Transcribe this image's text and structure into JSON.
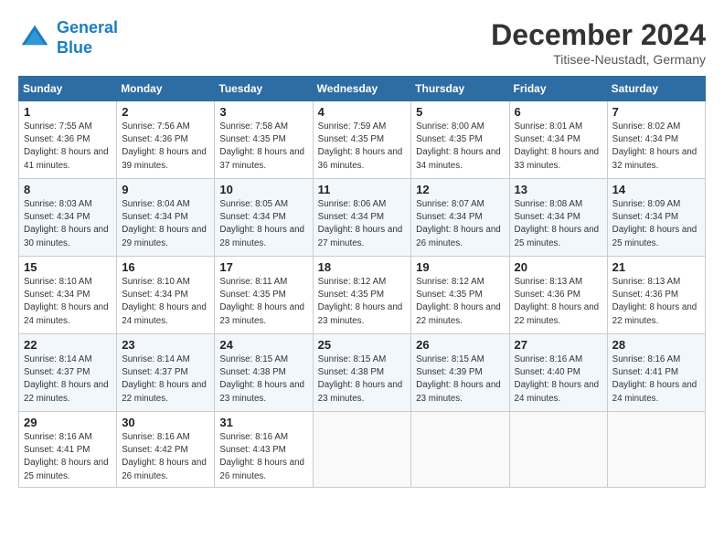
{
  "header": {
    "logo_line1": "General",
    "logo_line2": "Blue",
    "month_year": "December 2024",
    "location": "Titisee-Neustadt, Germany"
  },
  "weekdays": [
    "Sunday",
    "Monday",
    "Tuesday",
    "Wednesday",
    "Thursday",
    "Friday",
    "Saturday"
  ],
  "weeks": [
    [
      {
        "day": "1",
        "sunrise": "Sunrise: 7:55 AM",
        "sunset": "Sunset: 4:36 PM",
        "daylight": "Daylight: 8 hours and 41 minutes."
      },
      {
        "day": "2",
        "sunrise": "Sunrise: 7:56 AM",
        "sunset": "Sunset: 4:36 PM",
        "daylight": "Daylight: 8 hours and 39 minutes."
      },
      {
        "day": "3",
        "sunrise": "Sunrise: 7:58 AM",
        "sunset": "Sunset: 4:35 PM",
        "daylight": "Daylight: 8 hours and 37 minutes."
      },
      {
        "day": "4",
        "sunrise": "Sunrise: 7:59 AM",
        "sunset": "Sunset: 4:35 PM",
        "daylight": "Daylight: 8 hours and 36 minutes."
      },
      {
        "day": "5",
        "sunrise": "Sunrise: 8:00 AM",
        "sunset": "Sunset: 4:35 PM",
        "daylight": "Daylight: 8 hours and 34 minutes."
      },
      {
        "day": "6",
        "sunrise": "Sunrise: 8:01 AM",
        "sunset": "Sunset: 4:34 PM",
        "daylight": "Daylight: 8 hours and 33 minutes."
      },
      {
        "day": "7",
        "sunrise": "Sunrise: 8:02 AM",
        "sunset": "Sunset: 4:34 PM",
        "daylight": "Daylight: 8 hours and 32 minutes."
      }
    ],
    [
      {
        "day": "8",
        "sunrise": "Sunrise: 8:03 AM",
        "sunset": "Sunset: 4:34 PM",
        "daylight": "Daylight: 8 hours and 30 minutes."
      },
      {
        "day": "9",
        "sunrise": "Sunrise: 8:04 AM",
        "sunset": "Sunset: 4:34 PM",
        "daylight": "Daylight: 8 hours and 29 minutes."
      },
      {
        "day": "10",
        "sunrise": "Sunrise: 8:05 AM",
        "sunset": "Sunset: 4:34 PM",
        "daylight": "Daylight: 8 hours and 28 minutes."
      },
      {
        "day": "11",
        "sunrise": "Sunrise: 8:06 AM",
        "sunset": "Sunset: 4:34 PM",
        "daylight": "Daylight: 8 hours and 27 minutes."
      },
      {
        "day": "12",
        "sunrise": "Sunrise: 8:07 AM",
        "sunset": "Sunset: 4:34 PM",
        "daylight": "Daylight: 8 hours and 26 minutes."
      },
      {
        "day": "13",
        "sunrise": "Sunrise: 8:08 AM",
        "sunset": "Sunset: 4:34 PM",
        "daylight": "Daylight: 8 hours and 25 minutes."
      },
      {
        "day": "14",
        "sunrise": "Sunrise: 8:09 AM",
        "sunset": "Sunset: 4:34 PM",
        "daylight": "Daylight: 8 hours and 25 minutes."
      }
    ],
    [
      {
        "day": "15",
        "sunrise": "Sunrise: 8:10 AM",
        "sunset": "Sunset: 4:34 PM",
        "daylight": "Daylight: 8 hours and 24 minutes."
      },
      {
        "day": "16",
        "sunrise": "Sunrise: 8:10 AM",
        "sunset": "Sunset: 4:34 PM",
        "daylight": "Daylight: 8 hours and 24 minutes."
      },
      {
        "day": "17",
        "sunrise": "Sunrise: 8:11 AM",
        "sunset": "Sunset: 4:35 PM",
        "daylight": "Daylight: 8 hours and 23 minutes."
      },
      {
        "day": "18",
        "sunrise": "Sunrise: 8:12 AM",
        "sunset": "Sunset: 4:35 PM",
        "daylight": "Daylight: 8 hours and 23 minutes."
      },
      {
        "day": "19",
        "sunrise": "Sunrise: 8:12 AM",
        "sunset": "Sunset: 4:35 PM",
        "daylight": "Daylight: 8 hours and 22 minutes."
      },
      {
        "day": "20",
        "sunrise": "Sunrise: 8:13 AM",
        "sunset": "Sunset: 4:36 PM",
        "daylight": "Daylight: 8 hours and 22 minutes."
      },
      {
        "day": "21",
        "sunrise": "Sunrise: 8:13 AM",
        "sunset": "Sunset: 4:36 PM",
        "daylight": "Daylight: 8 hours and 22 minutes."
      }
    ],
    [
      {
        "day": "22",
        "sunrise": "Sunrise: 8:14 AM",
        "sunset": "Sunset: 4:37 PM",
        "daylight": "Daylight: 8 hours and 22 minutes."
      },
      {
        "day": "23",
        "sunrise": "Sunrise: 8:14 AM",
        "sunset": "Sunset: 4:37 PM",
        "daylight": "Daylight: 8 hours and 22 minutes."
      },
      {
        "day": "24",
        "sunrise": "Sunrise: 8:15 AM",
        "sunset": "Sunset: 4:38 PM",
        "daylight": "Daylight: 8 hours and 23 minutes."
      },
      {
        "day": "25",
        "sunrise": "Sunrise: 8:15 AM",
        "sunset": "Sunset: 4:38 PM",
        "daylight": "Daylight: 8 hours and 23 minutes."
      },
      {
        "day": "26",
        "sunrise": "Sunrise: 8:15 AM",
        "sunset": "Sunset: 4:39 PM",
        "daylight": "Daylight: 8 hours and 23 minutes."
      },
      {
        "day": "27",
        "sunrise": "Sunrise: 8:16 AM",
        "sunset": "Sunset: 4:40 PM",
        "daylight": "Daylight: 8 hours and 24 minutes."
      },
      {
        "day": "28",
        "sunrise": "Sunrise: 8:16 AM",
        "sunset": "Sunset: 4:41 PM",
        "daylight": "Daylight: 8 hours and 24 minutes."
      }
    ],
    [
      {
        "day": "29",
        "sunrise": "Sunrise: 8:16 AM",
        "sunset": "Sunset: 4:41 PM",
        "daylight": "Daylight: 8 hours and 25 minutes."
      },
      {
        "day": "30",
        "sunrise": "Sunrise: 8:16 AM",
        "sunset": "Sunset: 4:42 PM",
        "daylight": "Daylight: 8 hours and 26 minutes."
      },
      {
        "day": "31",
        "sunrise": "Sunrise: 8:16 AM",
        "sunset": "Sunset: 4:43 PM",
        "daylight": "Daylight: 8 hours and 26 minutes."
      },
      null,
      null,
      null,
      null
    ]
  ]
}
